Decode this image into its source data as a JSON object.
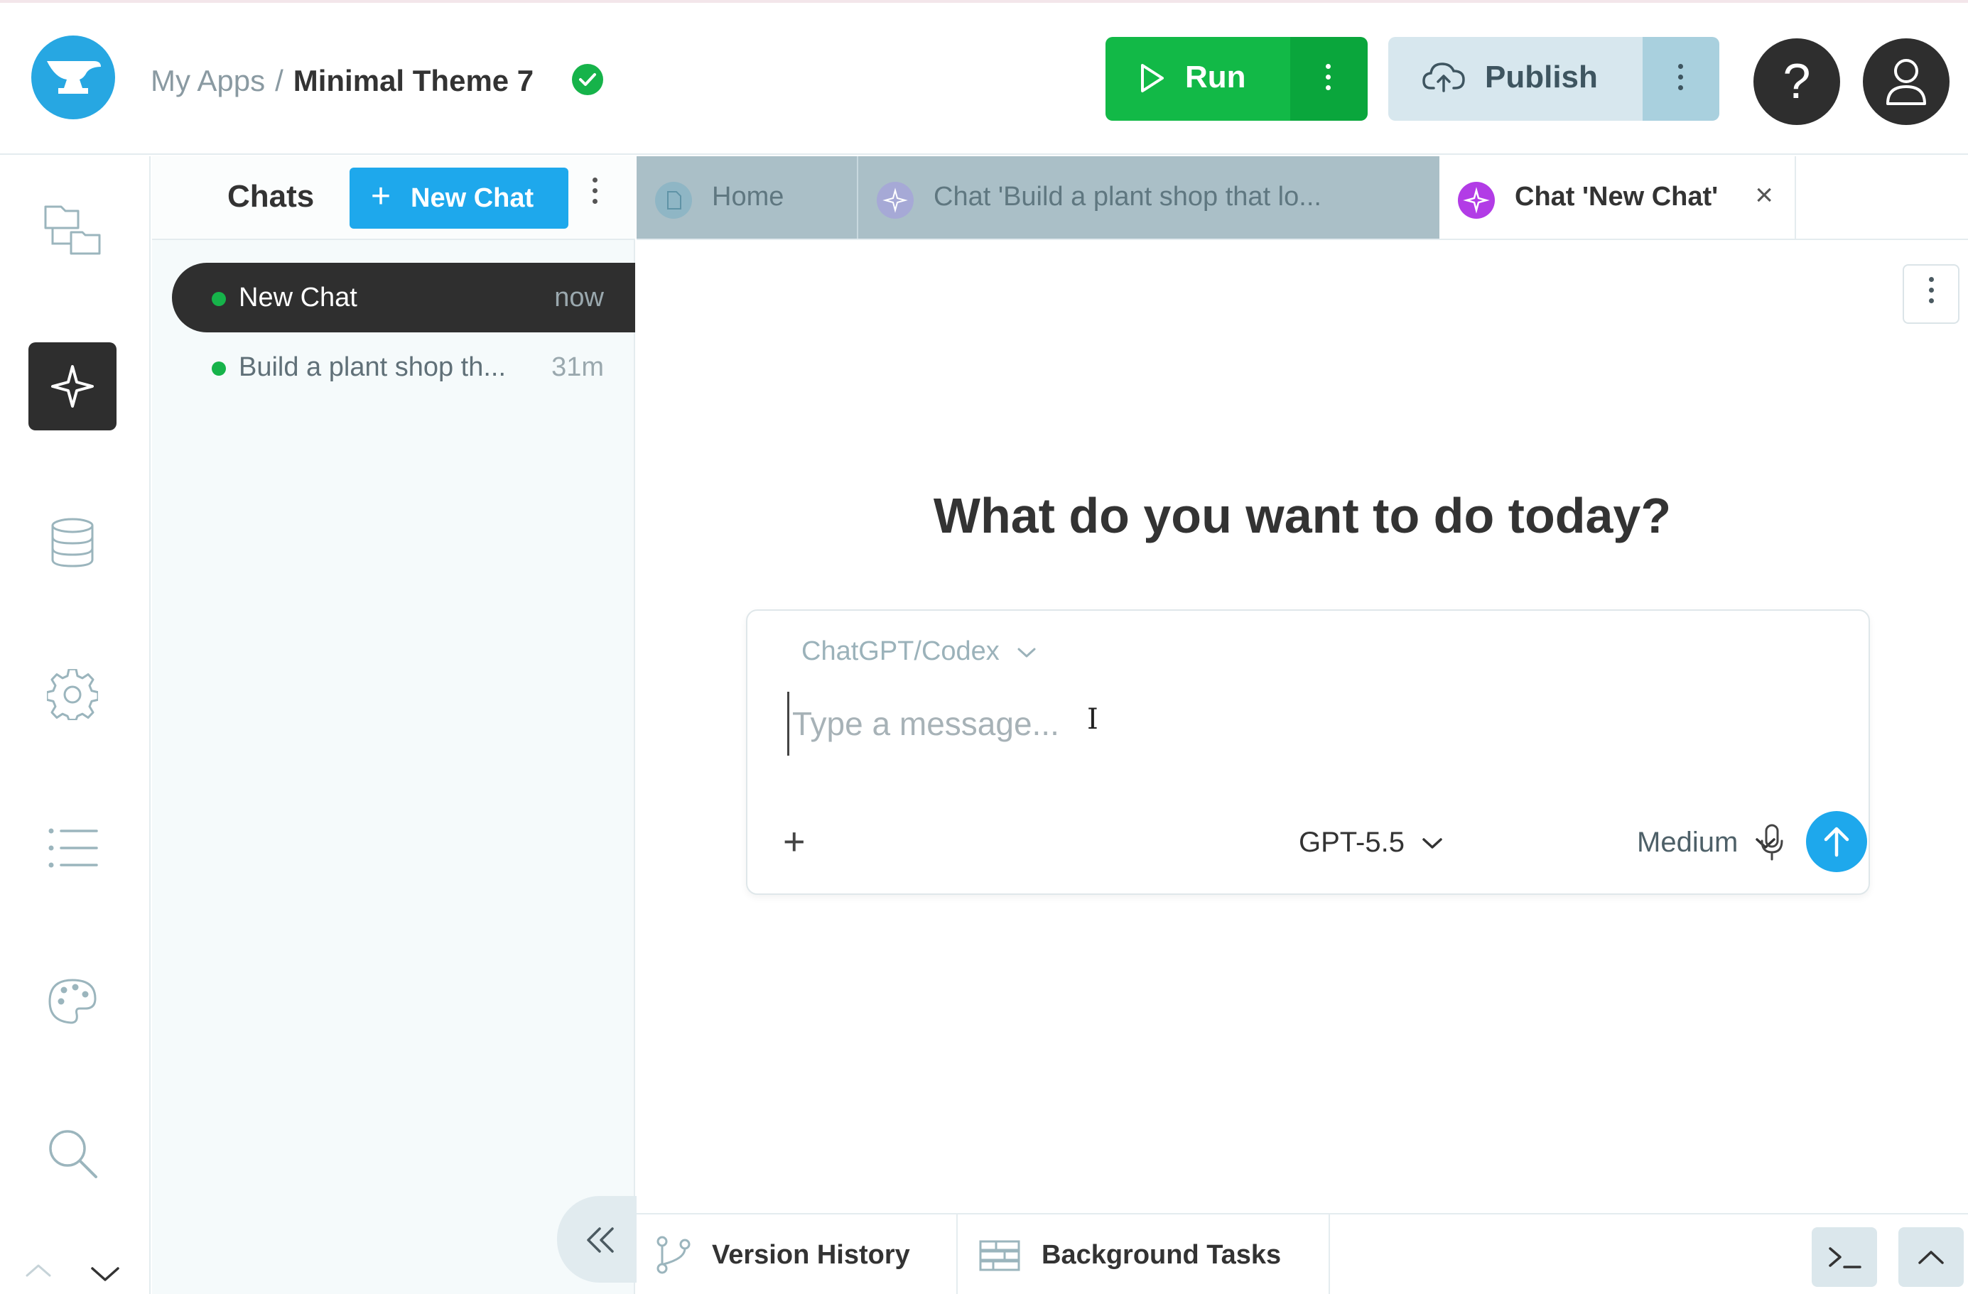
{
  "header": {
    "breadcrumb_root": "My Apps",
    "breadcrumb_sep": "/",
    "app_name": "Minimal Theme 7",
    "run_label": "Run",
    "publish_label": "Publish",
    "help_glyph": "?"
  },
  "rail": {
    "items": [
      {
        "icon": "file-tree-icon"
      },
      {
        "icon": "ai-sparkle-icon",
        "active": true
      },
      {
        "icon": "database-icon"
      },
      {
        "icon": "gear-icon"
      },
      {
        "icon": "list-icon"
      },
      {
        "icon": "palette-icon"
      },
      {
        "icon": "search-icon"
      }
    ]
  },
  "chats": {
    "title": "Chats",
    "new_chat_label": "New Chat",
    "new_chat_plus": "+",
    "items": [
      {
        "title": "New Chat",
        "time": "now",
        "active": true
      },
      {
        "title": "Build a plant shop th...",
        "time": "31m",
        "active": false
      }
    ]
  },
  "tabs": {
    "items": [
      {
        "label": "Home"
      },
      {
        "label": "Chat 'Build a plant shop that lo..."
      },
      {
        "label": "Chat 'New Chat'",
        "active": true
      }
    ],
    "close_glyph": "×"
  },
  "main": {
    "headline": "What do you want to do today?",
    "agent": "ChatGPT/Codex",
    "message_placeholder": "Type a message...",
    "attach_glyph": "+",
    "model": "GPT-5.5",
    "effort": "Medium"
  },
  "bottom": {
    "version_history": "Version History",
    "background_tasks": "Background Tasks"
  },
  "colors": {
    "accent_blue": "#1ea8ec",
    "run_green": "#12b947",
    "status_green": "#16b34a",
    "dark": "#2e2e2e"
  }
}
